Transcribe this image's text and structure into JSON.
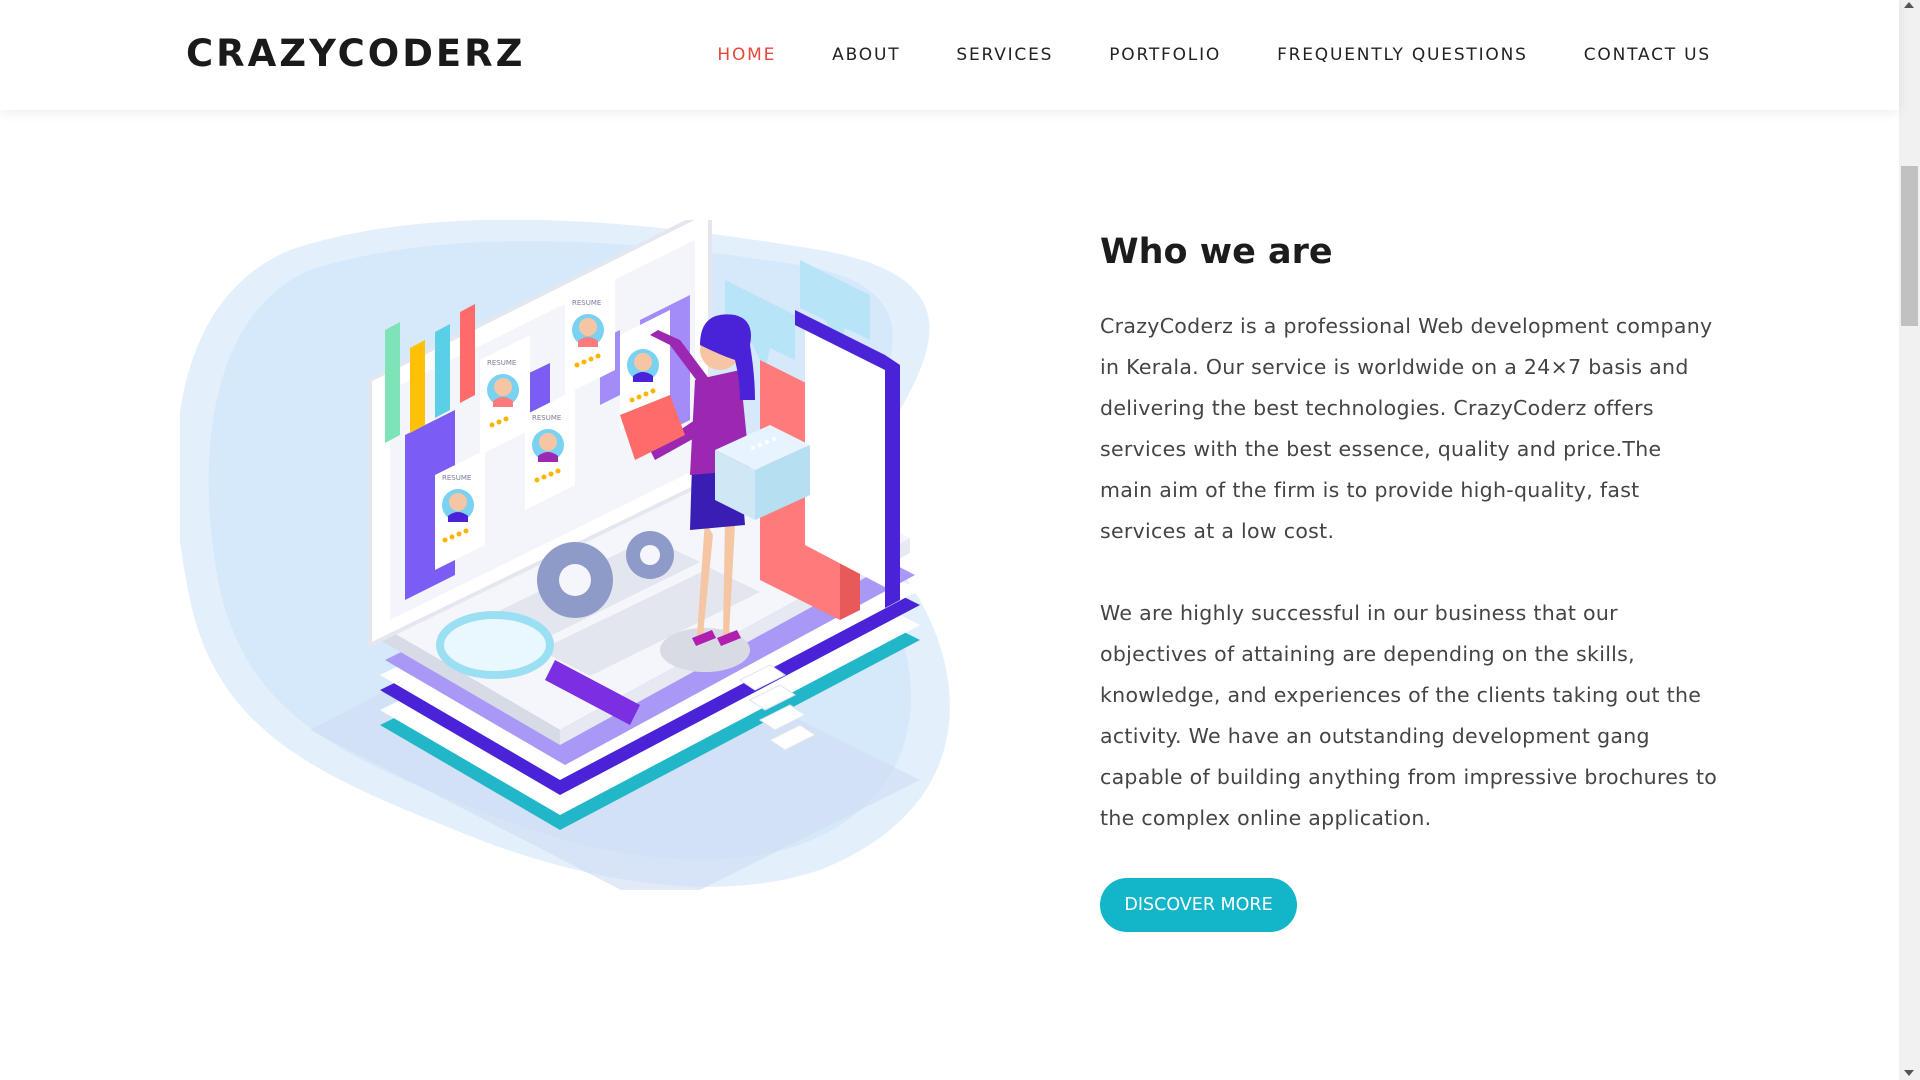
{
  "header": {
    "brand": "CRAZYCODERZ",
    "nav": [
      {
        "label": "HOME",
        "active": true
      },
      {
        "label": "ABOUT",
        "active": false
      },
      {
        "label": "SERVICES",
        "active": false
      },
      {
        "label": "PORTFOLIO",
        "active": false
      },
      {
        "label": "FREQUENTLY QUESTIONS",
        "active": false
      },
      {
        "label": "CONTACT US",
        "active": false
      }
    ]
  },
  "about": {
    "title": "Who we are",
    "paragraph1": "CrazyCoderz is a professional Web development company in Kerala. Our service is worldwide on a 24×7 basis and delivering the best technologies. CrazyCoderz offers services with the best essence, quality and price.The main aim of the firm is to provide high-quality, fast services at a low cost.",
    "paragraph2": "We are highly successful in our business that our objectives of attaining are depending on the skills, knowledge, and experiences of the clients taking out the activity. We have an outstanding development gang capable of building anything from impressive brochures to the complex online application.",
    "button_label": "DISCOVER MORE"
  },
  "illustration": {
    "resume_label": "RESUME"
  },
  "colors": {
    "accent": "#13b5c8",
    "active_nav": "#e8453c",
    "purple": "#7b5cf5",
    "coral": "#ff7a7a"
  }
}
